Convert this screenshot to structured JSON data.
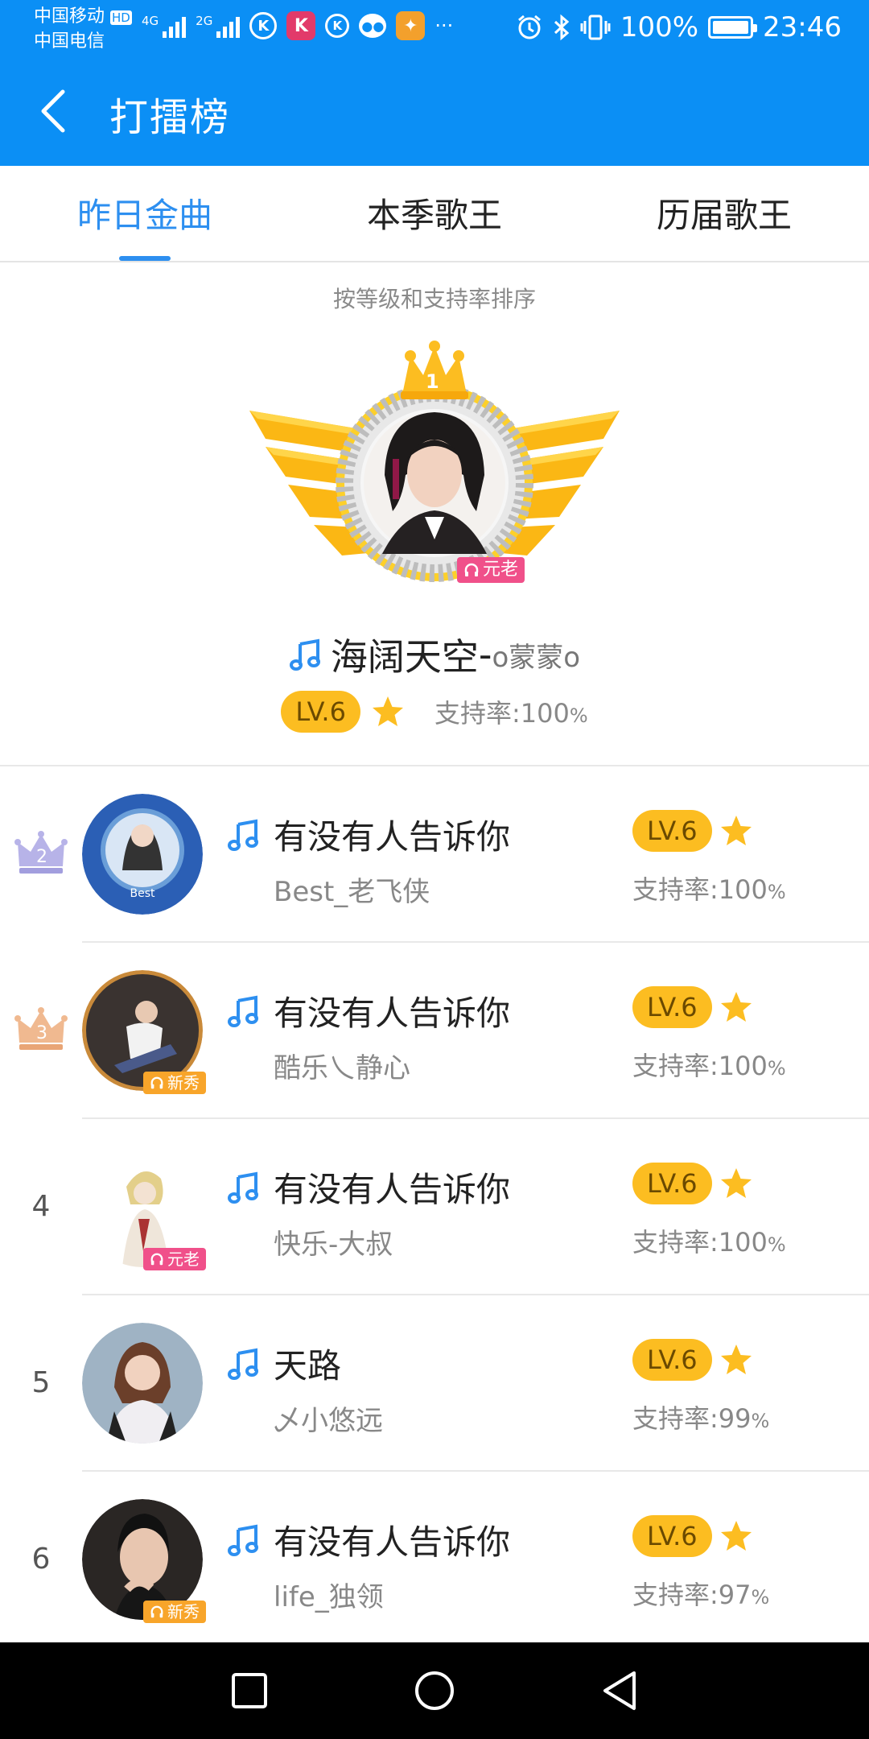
{
  "status_bar": {
    "carrier1": "中国移动",
    "carrier1_badge": "HD",
    "carrier2": "中国电信",
    "net1": "4G",
    "net2": "2G",
    "battery": "100%",
    "time": "23:46",
    "more": "···"
  },
  "header": {
    "title": "打擂榜",
    "back_icon": "chevron-left-icon"
  },
  "tabs": [
    {
      "label": "昨日金曲",
      "active": true
    },
    {
      "label": "本季歌王",
      "active": false
    },
    {
      "label": "历届歌王",
      "active": false
    }
  ],
  "sort_hint": "按等级和支持率排序",
  "champion": {
    "rank": "1",
    "song": "海阔天空",
    "separator": "-",
    "singer": "o蒙蒙o",
    "badge": "元老",
    "level": "LV.6",
    "rate_label": "支持率:",
    "rate_value": "100",
    "rate_unit": "%"
  },
  "list": [
    {
      "rank": "2",
      "song": "有没有人告诉你",
      "singer": "Best_老飞侠",
      "level": "LV.6",
      "rate_label": "支持率:",
      "rate_value": "100",
      "rate_unit": "%",
      "badge": "",
      "avatar_color": "#2b5fb5"
    },
    {
      "rank": "3",
      "song": "有没有人告诉你",
      "singer": "酷乐乀静心",
      "level": "LV.6",
      "rate_label": "支持率:",
      "rate_value": "100",
      "rate_unit": "%",
      "badge": "新秀",
      "avatar_color": "#3a3330"
    },
    {
      "rank": "4",
      "song": "有没有人告诉你",
      "singer": "快乐-大叔",
      "level": "LV.6",
      "rate_label": "支持率:",
      "rate_value": "100",
      "rate_unit": "%",
      "badge": "元老",
      "avatar_color": "#e9ddc6"
    },
    {
      "rank": "5",
      "song": "天路",
      "singer": "乄小悠远",
      "level": "LV.6",
      "rate_label": "支持率:",
      "rate_value": "99",
      "rate_unit": "%",
      "badge": "",
      "avatar_color": "#c9a08a"
    },
    {
      "rank": "6",
      "song": "有没有人告诉你",
      "singer": "life_独领",
      "level": "LV.6",
      "rate_label": "支持率:",
      "rate_value": "97",
      "rate_unit": "%",
      "badge": "新秀",
      "avatar_color": "#2a2624"
    }
  ],
  "colors": {
    "brand": "#0b8ff5",
    "tab_active": "#2d8ff0",
    "level_badge": "#fcbd21",
    "star": "#fcbd21",
    "badge_new": "#f8a52a",
    "badge_old": "#f0508a",
    "crown_2": "#b7b3e8",
    "crown_3": "#f0b990"
  }
}
